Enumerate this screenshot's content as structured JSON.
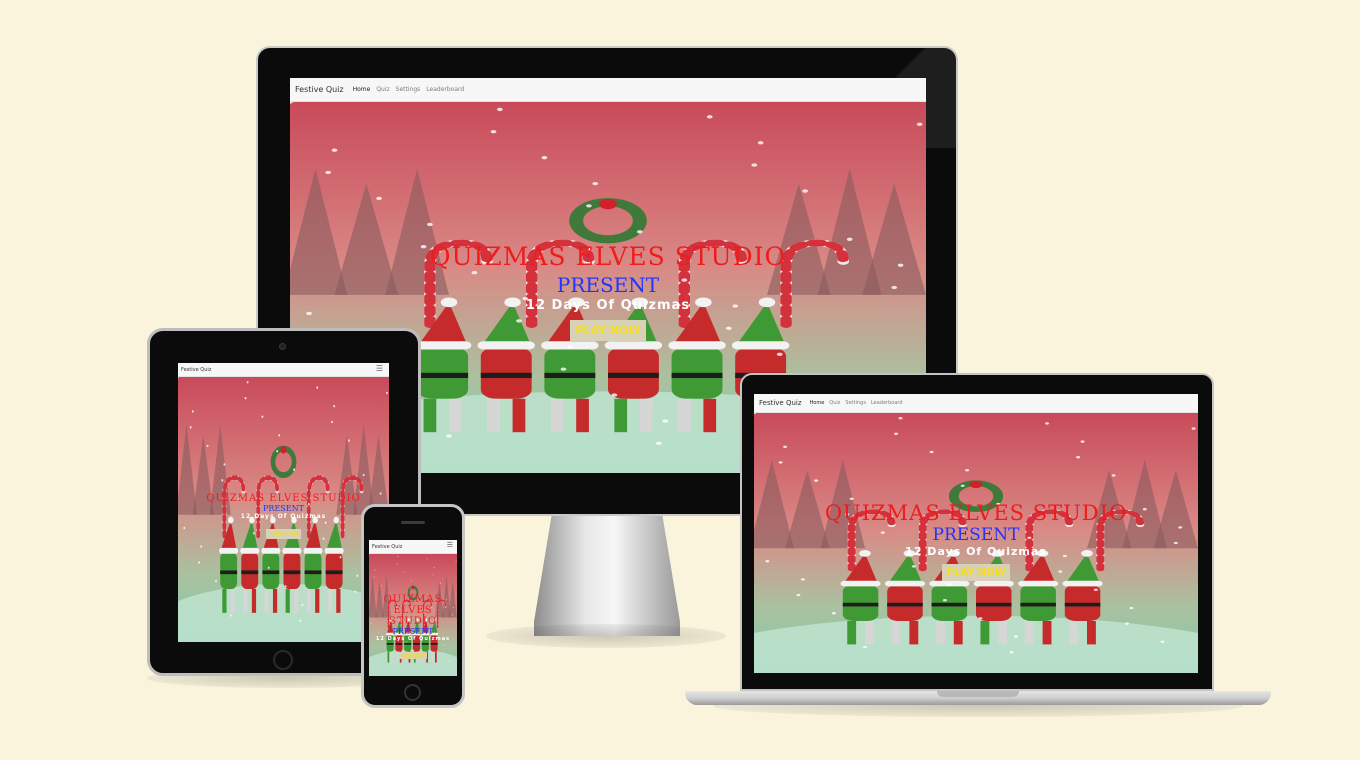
{
  "site": {
    "brand": "Festive Quiz",
    "nav": [
      "Home",
      "Quiz",
      "Settings",
      "Leaderboard"
    ],
    "active_nav": "Home",
    "hero_title": "QUIZMAS ELVES STUDIO",
    "hero_present": "PRESENT",
    "hero_subtitle": "12 Days Of Quizmas",
    "cta_label": "PLAY NOW",
    "menu_icon": "hamburger-icon"
  },
  "colors": {
    "page_background": "#faf4dc",
    "title_red": "#ef1c1c",
    "present_blue": "#1e34ff",
    "cta_text": "#f4de1a",
    "cta_background": "#d9d0b8"
  }
}
